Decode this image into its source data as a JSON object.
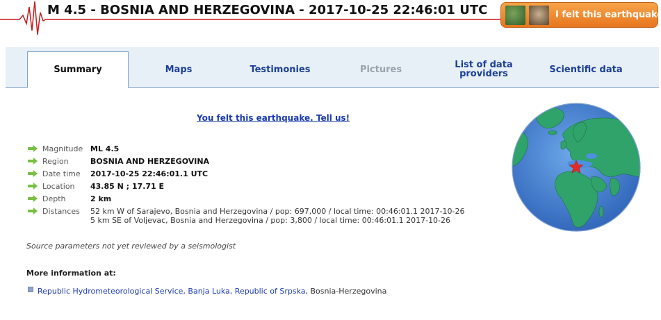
{
  "header": {
    "title": "M 4.5 - BOSNIA AND HERZEGOVINA - 2017-10-25 22:46:01 UTC",
    "felt_button_label": "I felt this earthquake"
  },
  "tabs": [
    {
      "label": "Summary",
      "state": "active"
    },
    {
      "label": "Maps",
      "state": "normal"
    },
    {
      "label": "Testimonies",
      "state": "normal"
    },
    {
      "label": "Pictures",
      "state": "disabled"
    },
    {
      "label_line1": "List of data",
      "label_line2": "providers",
      "state": "normal"
    },
    {
      "label": "Scientific data",
      "state": "normal"
    }
  ],
  "tell_us_link": "You felt this earthquake. Tell us!",
  "details": {
    "magnitude": {
      "label": "Magnitude",
      "value": "ML 4.5"
    },
    "region": {
      "label": "Region",
      "value": "BOSNIA AND HERZEGOVINA"
    },
    "datetime": {
      "label": "Date time",
      "value": "2017-10-25 22:46:01.1 UTC"
    },
    "location": {
      "label": "Location",
      "value": "43.85 N ; 17.71 E"
    },
    "depth": {
      "label": "Depth",
      "value": "2 km"
    },
    "distances": {
      "label": "Distances",
      "line1": "52 km W of Sarajevo, Bosnia and Herzegovina / pop: 697,000 / local time: 00:46:01.1 2017-10-26",
      "line2": "5 km SE of Voljevac, Bosnia and Herzegovina / pop: 3,800 / local time: 00:46:01.1 2017-10-26"
    }
  },
  "source_note": "Source parameters not yet reviewed by a seismologist",
  "more_info": {
    "title": "More information at:",
    "link_text": "Republic Hydrometeorological Service, Banja Luka, Republic of Srpska",
    "suffix": ", Bosnia-Herzegovina"
  },
  "colors": {
    "ocean": "#3f7fd0",
    "land": "#2fa36a",
    "tab_text": "#1a3f95",
    "button": "#e7761f",
    "epicenter": "#e52a1f",
    "arrow": "#78c043"
  },
  "icons": [
    "seismogram-icon",
    "arrow-right-icon",
    "square-bullet-icon",
    "globe-map",
    "epicenter-star-icon"
  ]
}
